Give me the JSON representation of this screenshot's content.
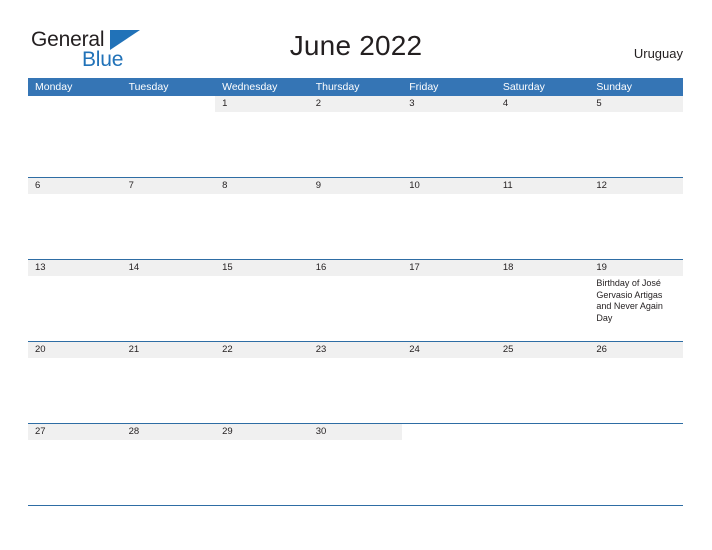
{
  "brand": {
    "logo_text_primary": "General",
    "logo_text_secondary": "Blue",
    "logo_icon": "triangle-flag-icon",
    "primary_color": "#2172b8"
  },
  "header": {
    "title": "June 2022",
    "country": "Uruguay"
  },
  "calendar": {
    "header_background": "#3575b5",
    "row_band_color": "#f0f0f0",
    "rule_color": "#2e6da4",
    "day_names": [
      "Monday",
      "Tuesday",
      "Wednesday",
      "Thursday",
      "Friday",
      "Saturday",
      "Sunday"
    ],
    "weeks": [
      {
        "days": [
          {
            "number": "",
            "in_month": false,
            "events": []
          },
          {
            "number": "",
            "in_month": false,
            "events": []
          },
          {
            "number": "1",
            "in_month": true,
            "events": []
          },
          {
            "number": "2",
            "in_month": true,
            "events": []
          },
          {
            "number": "3",
            "in_month": true,
            "events": []
          },
          {
            "number": "4",
            "in_month": true,
            "events": []
          },
          {
            "number": "5",
            "in_month": true,
            "events": []
          }
        ]
      },
      {
        "days": [
          {
            "number": "6",
            "in_month": true,
            "events": []
          },
          {
            "number": "7",
            "in_month": true,
            "events": []
          },
          {
            "number": "8",
            "in_month": true,
            "events": []
          },
          {
            "number": "9",
            "in_month": true,
            "events": []
          },
          {
            "number": "10",
            "in_month": true,
            "events": []
          },
          {
            "number": "11",
            "in_month": true,
            "events": []
          },
          {
            "number": "12",
            "in_month": true,
            "events": []
          }
        ]
      },
      {
        "days": [
          {
            "number": "13",
            "in_month": true,
            "events": []
          },
          {
            "number": "14",
            "in_month": true,
            "events": []
          },
          {
            "number": "15",
            "in_month": true,
            "events": []
          },
          {
            "number": "16",
            "in_month": true,
            "events": []
          },
          {
            "number": "17",
            "in_month": true,
            "events": []
          },
          {
            "number": "18",
            "in_month": true,
            "events": []
          },
          {
            "number": "19",
            "in_month": true,
            "events": [
              "Birthday of José Gervasio Artigas and Never Again Day"
            ]
          }
        ]
      },
      {
        "days": [
          {
            "number": "20",
            "in_month": true,
            "events": []
          },
          {
            "number": "21",
            "in_month": true,
            "events": []
          },
          {
            "number": "22",
            "in_month": true,
            "events": []
          },
          {
            "number": "23",
            "in_month": true,
            "events": []
          },
          {
            "number": "24",
            "in_month": true,
            "events": []
          },
          {
            "number": "25",
            "in_month": true,
            "events": []
          },
          {
            "number": "26",
            "in_month": true,
            "events": []
          }
        ]
      },
      {
        "days": [
          {
            "number": "27",
            "in_month": true,
            "events": []
          },
          {
            "number": "28",
            "in_month": true,
            "events": []
          },
          {
            "number": "29",
            "in_month": true,
            "events": []
          },
          {
            "number": "30",
            "in_month": true,
            "events": []
          },
          {
            "number": "",
            "in_month": false,
            "events": []
          },
          {
            "number": "",
            "in_month": false,
            "events": []
          },
          {
            "number": "",
            "in_month": false,
            "events": []
          }
        ]
      }
    ]
  }
}
